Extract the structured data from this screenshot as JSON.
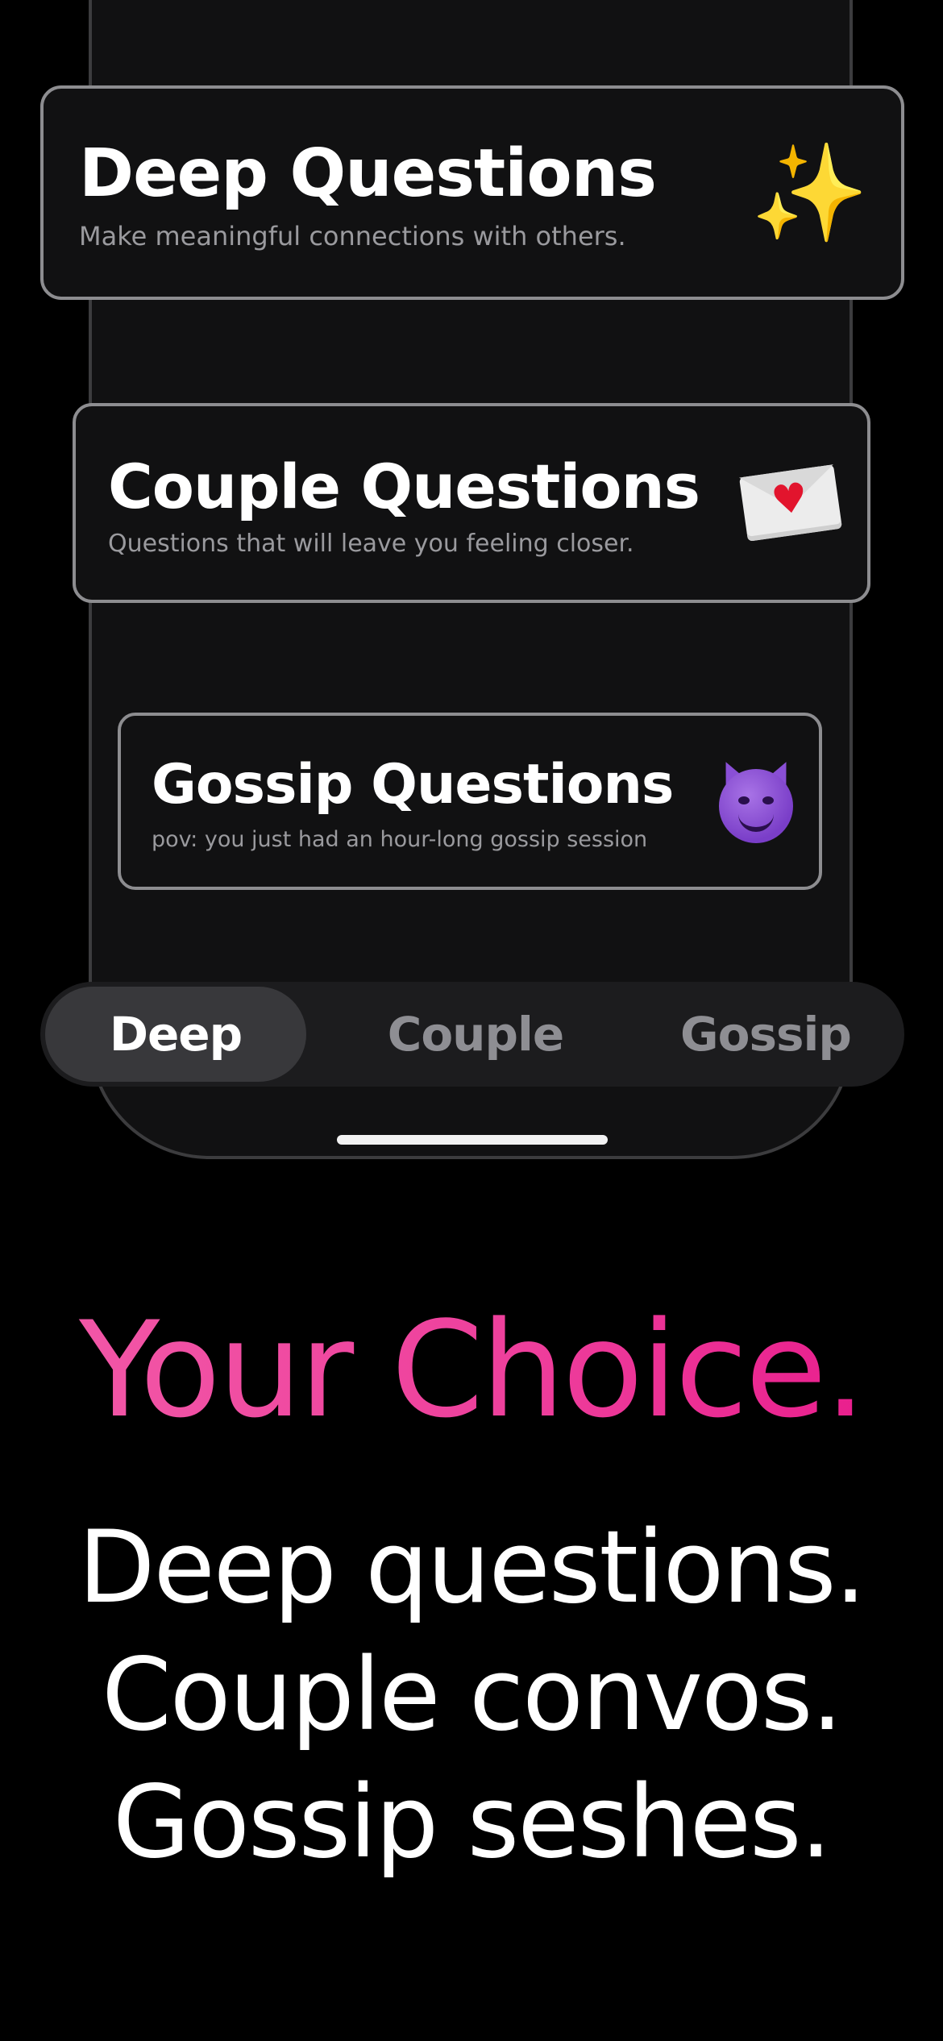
{
  "cards": [
    {
      "title": "Deep Questions",
      "subtitle": "Make meaningful connections with others.",
      "icon": "sparkles-icon",
      "icon_glyph": "✨"
    },
    {
      "title": "Couple Questions",
      "subtitle": "Questions that will leave you feeling closer.",
      "icon": "love-letter-icon",
      "icon_glyph": "♥"
    },
    {
      "title": "Gossip Questions",
      "subtitle": "pov: you just had an hour-long gossip session",
      "icon": "smiling-devil-icon"
    }
  ],
  "tabs": [
    {
      "label": "Deep",
      "selected": true
    },
    {
      "label": "Couple",
      "selected": false
    },
    {
      "label": "Gossip",
      "selected": false
    }
  ],
  "headline": "Your Choice.",
  "taglines": [
    "Deep questions.",
    "Couple convos.",
    "Gossip seshes."
  ],
  "colors": {
    "background": "#000000",
    "card_background": "#111112",
    "card_border": "#8d8d90",
    "accent_pink": "#ee3f9c",
    "tab_selected": "#38383b",
    "tab_bar": "#1c1c1e"
  }
}
